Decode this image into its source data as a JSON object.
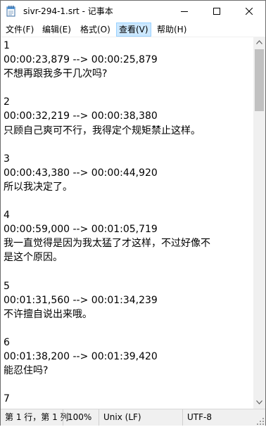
{
  "window": {
    "title": "sivr-294-1.srt - 记事本",
    "icon": "notepad-icon"
  },
  "menu": [
    {
      "label": "文件(F)"
    },
    {
      "label": "编辑(E)"
    },
    {
      "label": "格式(O)"
    },
    {
      "label": "查看(V)"
    },
    {
      "label": "帮助(H)"
    }
  ],
  "active_menu": "查看(V)",
  "editor": {
    "lines": [
      "1",
      "00:00:23,879 --> 00:00:25,879",
      "不想再跟我多干几次吗?",
      "",
      "2",
      "00:00:32,219 --> 00:00:38,380",
      "只顾自己爽可不行，我得定个规矩禁止这样。",
      "",
      "3",
      "00:00:43,380 --> 00:00:44,920",
      "所以我决定了。",
      "",
      "4",
      "00:00:59,000 --> 00:01:05,719",
      "我一直觉得是因为我太猛了才这样，不过好像不",
      "是这个原因。",
      "",
      "5",
      "00:01:31,560 --> 00:01:34,239",
      "不许擅自说出来哦。",
      "",
      "6",
      "00:01:38,200 --> 00:01:39,420",
      "能忍住吗?",
      "",
      "7"
    ]
  },
  "statusbar": {
    "position": "第 1 行，第 1 列",
    "zoom": "100%",
    "line_ending": "Unix (LF)",
    "encoding": "UTF-8"
  }
}
